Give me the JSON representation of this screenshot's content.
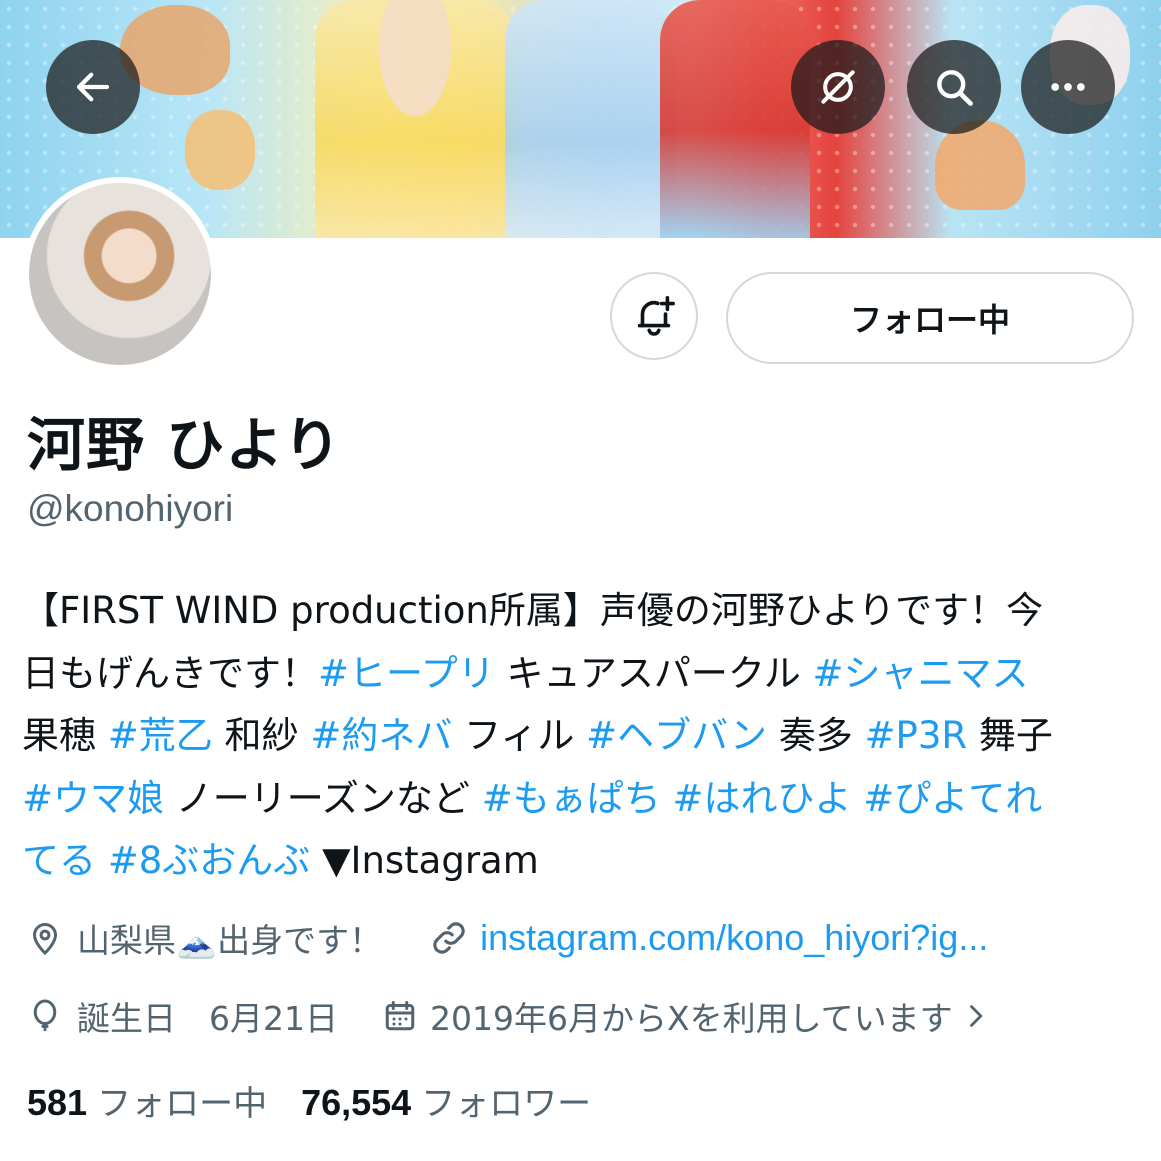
{
  "header": {
    "back_icon": "arrow-left-icon",
    "translate_icon": "translate-off-icon",
    "search_icon": "search-icon",
    "more_icon": "more-horizontal-icon"
  },
  "profile": {
    "display_name": "河野 ひより",
    "handle": "@konohiyori",
    "follow_button_label": "フォロー中",
    "notify_icon": "bell-plus-icon"
  },
  "bio": {
    "lines": [
      [
        {
          "t": "【FIRST WIND production所属】声優の河野ひよりです！今",
          "tag": false
        }
      ],
      [
        {
          "t": "日もげんきです！",
          "tag": false
        },
        {
          "t": "#ヒープリ",
          "tag": true
        },
        {
          "t": " キュアスパークル ",
          "tag": false
        },
        {
          "t": "#シャニマス",
          "tag": true
        }
      ],
      [
        {
          "t": "果穂 ",
          "tag": false
        },
        {
          "t": "#荒乙",
          "tag": true
        },
        {
          "t": " 和紗 ",
          "tag": false
        },
        {
          "t": "#約ネバ",
          "tag": true
        },
        {
          "t": " フィル ",
          "tag": false
        },
        {
          "t": "#ヘブバン",
          "tag": true
        },
        {
          "t": " 奏多 ",
          "tag": false
        },
        {
          "t": "#P3R",
          "tag": true
        },
        {
          "t": " 舞子",
          "tag": false
        }
      ],
      [
        {
          "t": "#ウマ娘",
          "tag": true
        },
        {
          "t": " ノーリーズンなど ",
          "tag": false
        },
        {
          "t": "#もぁぱち",
          "tag": true
        },
        {
          "t": " ",
          "tag": false
        },
        {
          "t": "#はれひよ",
          "tag": true
        },
        {
          "t": " ",
          "tag": false
        },
        {
          "t": "#ぴよてれ",
          "tag": true
        }
      ],
      [
        {
          "t": "てる",
          "tag": true
        },
        {
          "t": " ",
          "tag": false
        },
        {
          "t": "#8ぶおんぶ",
          "tag": true
        },
        {
          "t": " ▼Instagram",
          "tag": false
        }
      ]
    ]
  },
  "meta": {
    "location_icon": "location-pin-icon",
    "location_text": "山梨県🗻出身です！",
    "link_icon": "link-icon",
    "link_text": "instagram.com/kono_hiyori?ig...",
    "birthday_icon": "balloon-icon",
    "birthday_text": "誕生日　6月21日",
    "joined_icon": "calendar-icon",
    "joined_text": "2019年6月からXを利用しています",
    "joined_chevron_icon": "chevron-right-icon"
  },
  "stats": {
    "following_count": "581",
    "following_label": "フォロー中",
    "followers_count": "76,554",
    "followers_label": "フォロワー"
  },
  "colors": {
    "accent": "#1d9bf0",
    "text": "#0f1419",
    "secondary": "#536471",
    "border": "#cfd9de"
  }
}
